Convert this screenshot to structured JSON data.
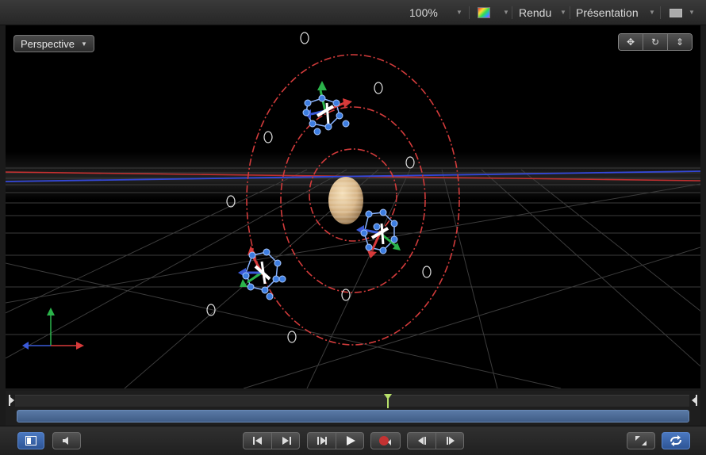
{
  "toolbar": {
    "zoom": "100%",
    "render_menu": "Rendu",
    "presentation_menu": "Présentation"
  },
  "viewport": {
    "camera_menu": "Perspective"
  },
  "colors": {
    "path_red": "#d23b3b",
    "handle_blue": "#3d7de0",
    "axis_green": "#2bb34a",
    "axis_red": "#d83a3a",
    "axis_blue": "#3a5ad8",
    "timeline_blue": "#4c6d9c"
  },
  "icons": {
    "top_right_controls": [
      "pan-icon",
      "orbit-icon",
      "dolly-icon"
    ],
    "transport": [
      "show-inspector-icon",
      "audio-icon",
      "go-to-start-icon",
      "go-to-end-icon",
      "previous-frame-icon",
      "play-icon",
      "record-icon",
      "previous-keyframe-icon",
      "next-keyframe-icon",
      "fullscreen-icon",
      "loop-icon"
    ]
  }
}
